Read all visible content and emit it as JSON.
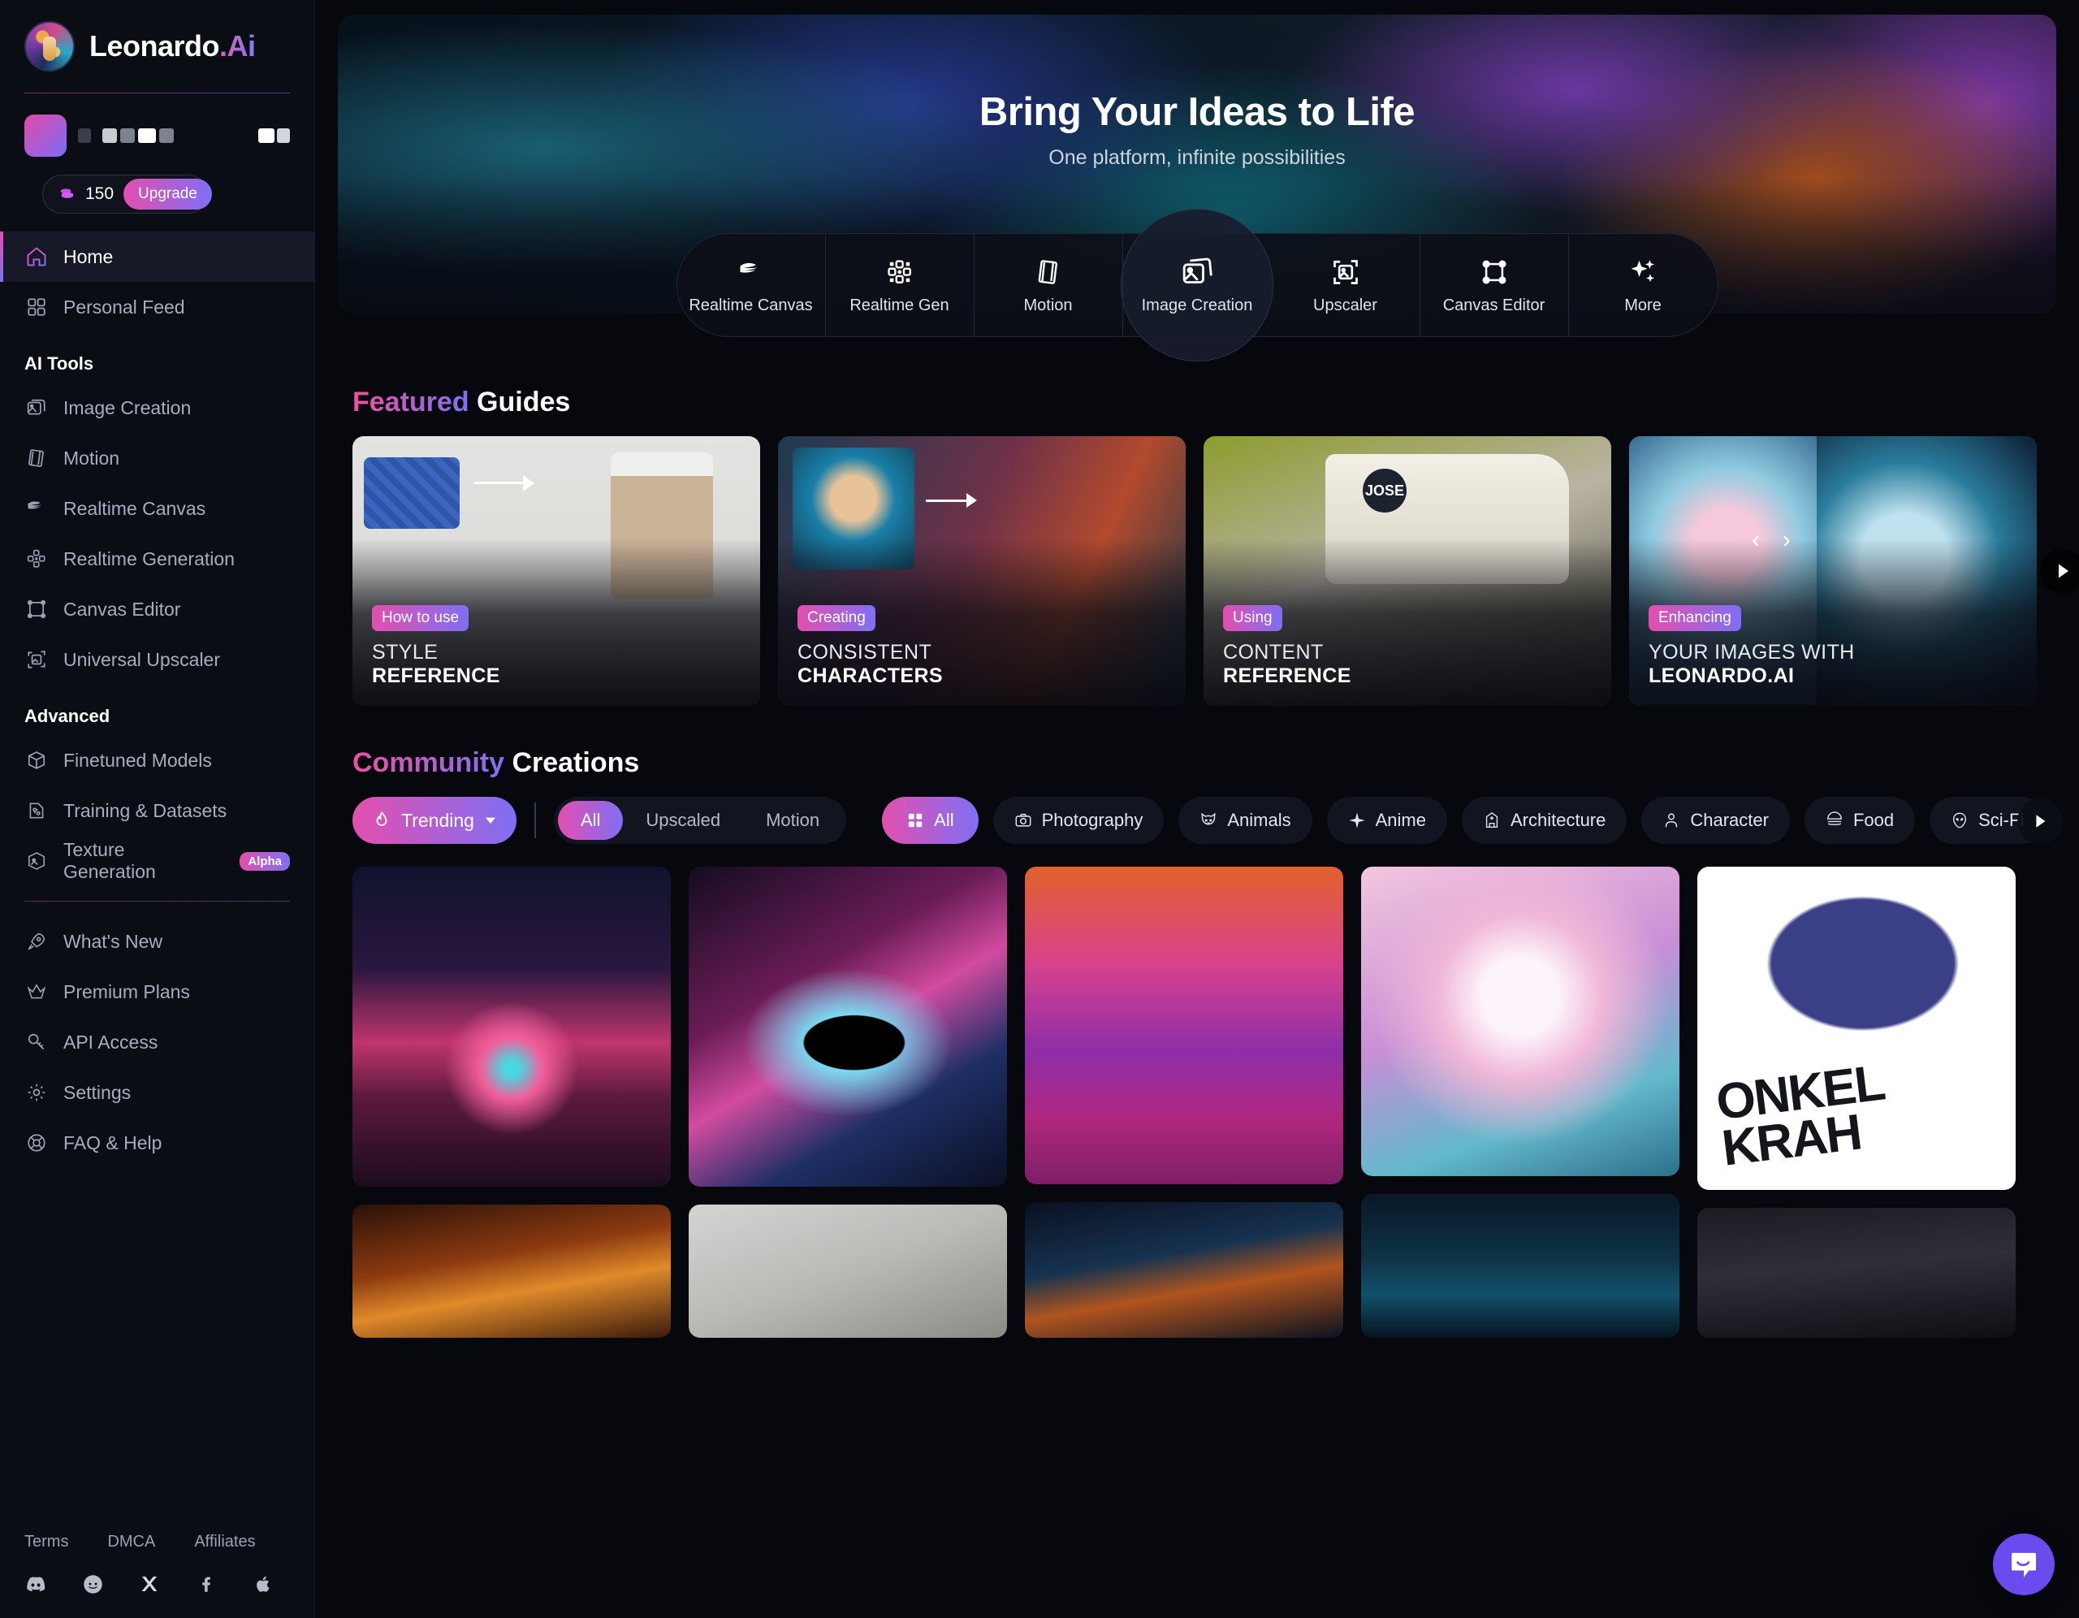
{
  "brand": {
    "name": "Leonardo",
    "suffix": ".Ai",
    "logo_icon": "leonardo-logo-icon"
  },
  "account": {
    "credits_value": "150",
    "credits_icon": "coin-stack-icon",
    "upgrade_label": "Upgrade"
  },
  "sidebar": {
    "primary": [
      {
        "label": "Home",
        "icon": "home-icon",
        "active": true
      },
      {
        "label": "Personal Feed",
        "icon": "grid-icon",
        "active": false
      }
    ],
    "ai_tools_label": "AI Tools",
    "ai_tools": [
      {
        "label": "Image Creation",
        "icon": "image-stack-icon"
      },
      {
        "label": "Motion",
        "icon": "film-strip-icon"
      },
      {
        "label": "Realtime Canvas",
        "icon": "brush-strokes-icon"
      },
      {
        "label": "Realtime Generation",
        "icon": "realtime-gen-icon"
      },
      {
        "label": "Canvas Editor",
        "icon": "frame-nodes-icon"
      },
      {
        "label": "Universal Upscaler",
        "icon": "upscale-image-icon"
      }
    ],
    "advanced_label": "Advanced",
    "advanced": [
      {
        "label": "Finetuned Models",
        "icon": "cube-icon",
        "badge": ""
      },
      {
        "label": "Training & Datasets",
        "icon": "training-icon",
        "badge": ""
      },
      {
        "label": "Texture Generation",
        "icon": "texture-cube-icon",
        "badge": "Alpha"
      }
    ],
    "misc": [
      {
        "label": "What's New",
        "icon": "rocket-icon"
      },
      {
        "label": "Premium Plans",
        "icon": "crown-icon"
      },
      {
        "label": "API Access",
        "icon": "key-icon"
      },
      {
        "label": "Settings",
        "icon": "gear-icon"
      },
      {
        "label": "FAQ & Help",
        "icon": "lifebuoy-icon"
      }
    ],
    "footer_links": [
      "Terms",
      "DMCA",
      "Affiliates"
    ],
    "socials": [
      {
        "name": "discord-icon",
        "glyph": "✦"
      },
      {
        "name": "reddit-icon",
        "glyph": "◉"
      },
      {
        "name": "x-icon",
        "glyph": "𝕏"
      },
      {
        "name": "facebook-icon",
        "glyph": "f"
      },
      {
        "name": "apple-icon",
        "glyph": ""
      }
    ]
  },
  "hero": {
    "title": "Bring Your Ideas to Life",
    "subtitle": "One platform, infinite possibilities"
  },
  "toolbar": [
    {
      "label": "Realtime Canvas",
      "icon": "brush-strokes-icon",
      "selected": false
    },
    {
      "label": "Realtime Gen",
      "icon": "realtime-gen-icon",
      "selected": false
    },
    {
      "label": "Motion",
      "icon": "film-strip-icon",
      "selected": false
    },
    {
      "label": "Image Creation",
      "icon": "image-stack-icon",
      "selected": true
    },
    {
      "label": "Upscaler",
      "icon": "upscale-image-icon",
      "selected": false
    },
    {
      "label": "Canvas Editor",
      "icon": "frame-nodes-icon",
      "selected": false
    },
    {
      "label": "More",
      "icon": "sparkles-icon",
      "selected": false
    }
  ],
  "featured": {
    "heading_accent": "Featured",
    "heading_rest": " Guides",
    "cards": [
      {
        "tag": "How to use",
        "line1": "STYLE",
        "line2": "REFERENCE"
      },
      {
        "tag": "Creating",
        "line1": "CONSISTENT",
        "line2": "CHARACTERS"
      },
      {
        "tag": "Using",
        "line1": "CONTENT",
        "line2": "REFERENCE"
      },
      {
        "tag": "Enhancing",
        "line1": "YOUR IMAGES WITH",
        "line2": "LEONARDO.AI"
      }
    ],
    "prev_icon": "chevron-left-icon",
    "next_icon": "chevron-right-icon",
    "next_page_icon": "play-arrow-icon"
  },
  "community": {
    "heading_accent": "Community",
    "heading_rest": " Creations",
    "sort": {
      "label": "Trending",
      "icon": "flame-icon",
      "chevron": "chevron-down-icon"
    },
    "type_filters": [
      {
        "label": "All",
        "selected": true
      },
      {
        "label": "Upscaled",
        "selected": false
      },
      {
        "label": "Motion",
        "selected": false
      }
    ],
    "categories": [
      {
        "label": "All",
        "icon": "grid-icon",
        "selected": true
      },
      {
        "label": "Photography",
        "icon": "camera-icon",
        "selected": false
      },
      {
        "label": "Animals",
        "icon": "cat-icon",
        "selected": false
      },
      {
        "label": "Anime",
        "icon": "spark-icon",
        "selected": false
      },
      {
        "label": "Architecture",
        "icon": "building-icon",
        "selected": false
      },
      {
        "label": "Character",
        "icon": "person-icon",
        "selected": false
      },
      {
        "label": "Food",
        "icon": "burger-icon",
        "selected": false
      },
      {
        "label": "Sci-Fi",
        "icon": "alien-icon",
        "selected": false
      }
    ],
    "scroll_next_icon": "play-arrow-icon",
    "gallery": [
      {
        "name": "retro-sunset-car"
      },
      {
        "name": "black-hole-nebula"
      },
      {
        "name": "blue-eyeshadow-flowers-woman"
      },
      {
        "name": "fluffy-pink-kitten"
      },
      {
        "name": "onkel-krah-crow-poster",
        "caption": "ONKEL KRAH"
      },
      {
        "name": "orange-robot-head"
      },
      {
        "name": "words-gift-curse-book-cat"
      },
      {
        "name": "glowing-portal-ship"
      },
      {
        "name": "white-flower-dark-forest"
      },
      {
        "name": "cyberpunk-city-street"
      }
    ]
  },
  "chat": {
    "icon": "chat-bubble-icon"
  }
}
